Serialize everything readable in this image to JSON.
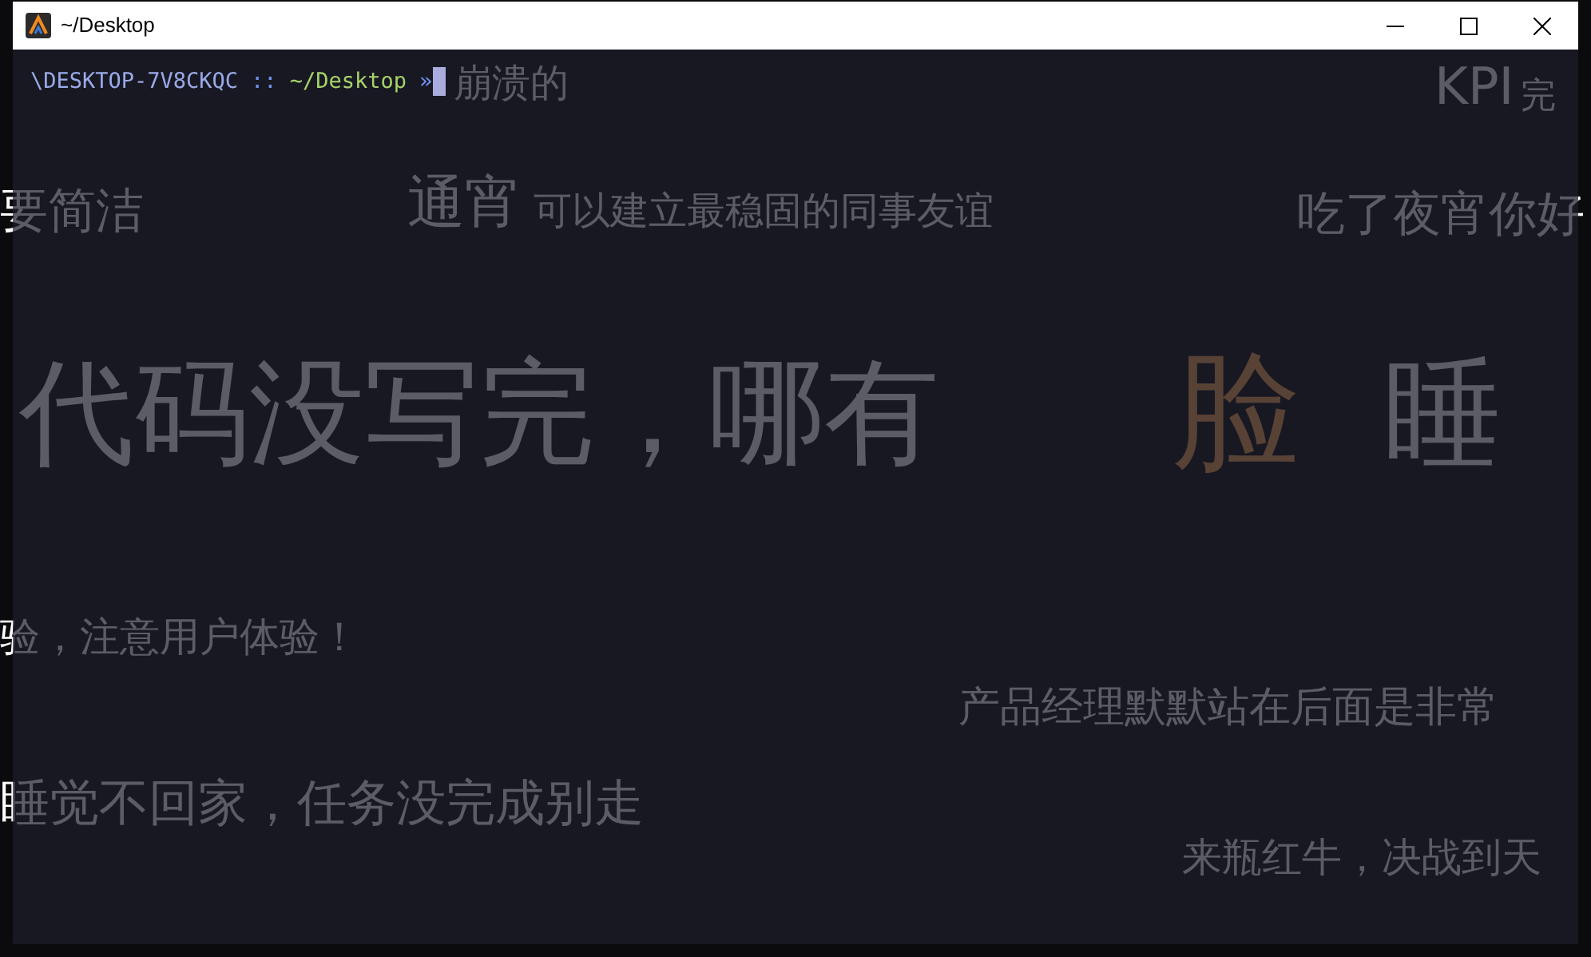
{
  "window": {
    "title": "~/Desktop"
  },
  "prompt": {
    "host": "\\DESKTOP-7V8CKQC",
    "separator": "::",
    "path": "~/Desktop",
    "symbol": "»"
  },
  "wallpaper": [
    {
      "text": "崩溃的",
      "kind": "plain"
    },
    {
      "text": "KPI",
      "kind": "plain"
    },
    {
      "text": "完",
      "kind": "plain"
    },
    {
      "text": "要简洁",
      "kind": "plain"
    },
    {
      "text": "通宵",
      "kind": "plain"
    },
    {
      "text": "可以建立最稳固的同事友谊",
      "kind": "plain"
    },
    {
      "text": "吃了夜宵你好",
      "kind": "plain"
    },
    {
      "text": "代码没写完，哪有",
      "kind": "plain"
    },
    {
      "text": "脸",
      "kind": "accent"
    },
    {
      "text": "睡",
      "kind": "plain"
    },
    {
      "text": "验，注意用户体验！",
      "kind": "plain"
    },
    {
      "text": "产品经理默默站在后面是非常",
      "kind": "plain"
    },
    {
      "text": "睡觉不回家，任务没完成别走",
      "kind": "plain"
    },
    {
      "text": "来瓶红牛，决战到天",
      "kind": "plain"
    }
  ]
}
